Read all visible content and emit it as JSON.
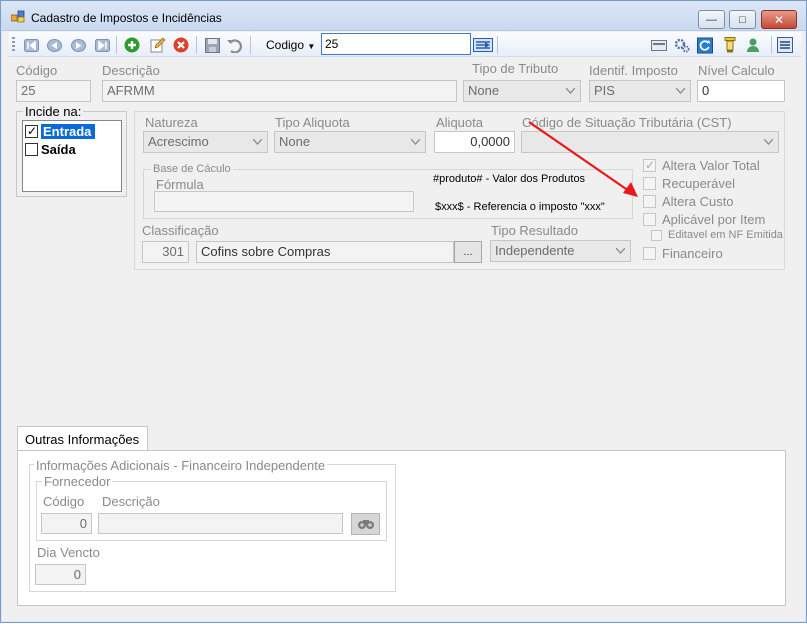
{
  "window": {
    "title": "Cadastro de Impostos e Incidências",
    "controls": {
      "minimize": "—",
      "maximize": "□",
      "close": "✕"
    }
  },
  "toolbar": {
    "search_field_label": "Codigo",
    "search_value": "25"
  },
  "header": {
    "codigo_label": "Código",
    "codigo_value": "25",
    "descricao_label": "Descrição",
    "descricao_value": "AFRMM",
    "tipo_tributo_label": "Tipo de Tributo",
    "tipo_tributo_value": "None",
    "identif_imposto_label": "Identif. Imposto",
    "identif_imposto_value": "PIS",
    "nivel_calculo_label": "Nível Calculo",
    "nivel_calculo_value": "0"
  },
  "incide": {
    "title": "Incide na:",
    "items": [
      {
        "label": "Entrada",
        "checked": true
      },
      {
        "label": "Saída",
        "checked": false
      }
    ]
  },
  "details": {
    "natureza_label": "Natureza",
    "natureza_value": "Acrescimo",
    "tipo_aliquota_label": "Tipo Aliquota",
    "tipo_aliquota_value": "None",
    "aliquota_label": "Aliquota",
    "aliquota_value": "0,0000",
    "cst_label": "Código de Situação Tributária (CST)",
    "cst_value": "",
    "base_calculo_title": "Base de Cáculo",
    "formula_label": "Fórmula",
    "formula_value": "",
    "note_produto": "#produto# - Valor dos Produtos",
    "note_imposto": "$xxx$ - Referencia o imposto \"xxx\"",
    "classificacao_label": "Classificação",
    "classificacao_code": "301",
    "classificacao_desc": "Cofins sobre Compras",
    "classificacao_button": "...",
    "tipo_resultado_label": "Tipo Resultado",
    "tipo_resultado_value": "Independente"
  },
  "options": {
    "altera_valor_total": "Altera Valor Total",
    "recuperavel": "Recuperável",
    "altera_custo": "Altera Custo",
    "aplicavel_por_item": "Aplicável por Item",
    "editavel_nf_emitida": "Editavel em NF Emitida",
    "financeiro": "Financeiro"
  },
  "outras": {
    "tab_label": "Outras Informações",
    "group_title": "Informações Adicionais - Financeiro Independente",
    "fornecedor_title": "Fornecedor",
    "codigo_label": "Código",
    "codigo_value": "0",
    "descricao_label": "Descrição",
    "descricao_value": "",
    "dia_vencto_label": "Dia Vencto",
    "dia_vencto_value": "0"
  },
  "icons": [
    "first-record-icon",
    "previous-record-icon",
    "next-record-icon",
    "last-record-icon",
    "add-icon",
    "edit-icon",
    "delete-icon",
    "save-icon",
    "undo-icon",
    "search-go-icon",
    "card-icon",
    "gears-icon",
    "refresh-icon",
    "filter-icon",
    "user-icon",
    "menu-icon",
    "binoculars-icon",
    "dropdown-arrow-icon"
  ],
  "colors": {
    "accent": "#0a6ad6",
    "annotation_arrow": "#e8191a",
    "add_green": "#2e9b2e",
    "delete_red": "#d9432b"
  }
}
